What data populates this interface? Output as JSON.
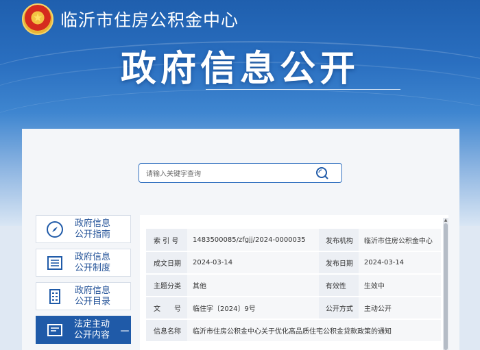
{
  "header": {
    "org_name": "临沂市住房公积金中心",
    "title": "政府信息公开",
    "brand_color": "#1f5fae"
  },
  "search": {
    "placeholder": "请输入关键字查询",
    "icon": "search-icon"
  },
  "sidebar": {
    "items": [
      {
        "label": "政府信息公开指南",
        "icon": "compass-icon",
        "active": false
      },
      {
        "label": "政府信息公开制度",
        "icon": "document-list-icon",
        "active": false
      },
      {
        "label": "政府信息公开目录",
        "icon": "catalog-icon",
        "active": false
      },
      {
        "label": "法定主动公开内容",
        "icon": "mail-document-icon",
        "active": true,
        "toggle": "－"
      }
    ]
  },
  "info": {
    "rows": [
      {
        "l1": "索 引 号",
        "v1": "1483500085/zfgjj/2024-0000035",
        "l2": "发布机构",
        "v2": "临沂市住房公积金中心"
      },
      {
        "l1": "成文日期",
        "v1": "2024-03-14",
        "l2": "发布日期",
        "v2": "2024-03-14"
      },
      {
        "l1": "主题分类",
        "v1": "其他",
        "l2": "有效性",
        "v2": "生效中"
      },
      {
        "l1": "文　　号",
        "v1": "临住字〔2024〕9号",
        "l2": "公开方式",
        "v2": "主动公开"
      }
    ],
    "name_label": "信息名称",
    "name_value": "临沂市住房公积金中心关于优化高品质住宅公积金贷款政策的通知"
  }
}
